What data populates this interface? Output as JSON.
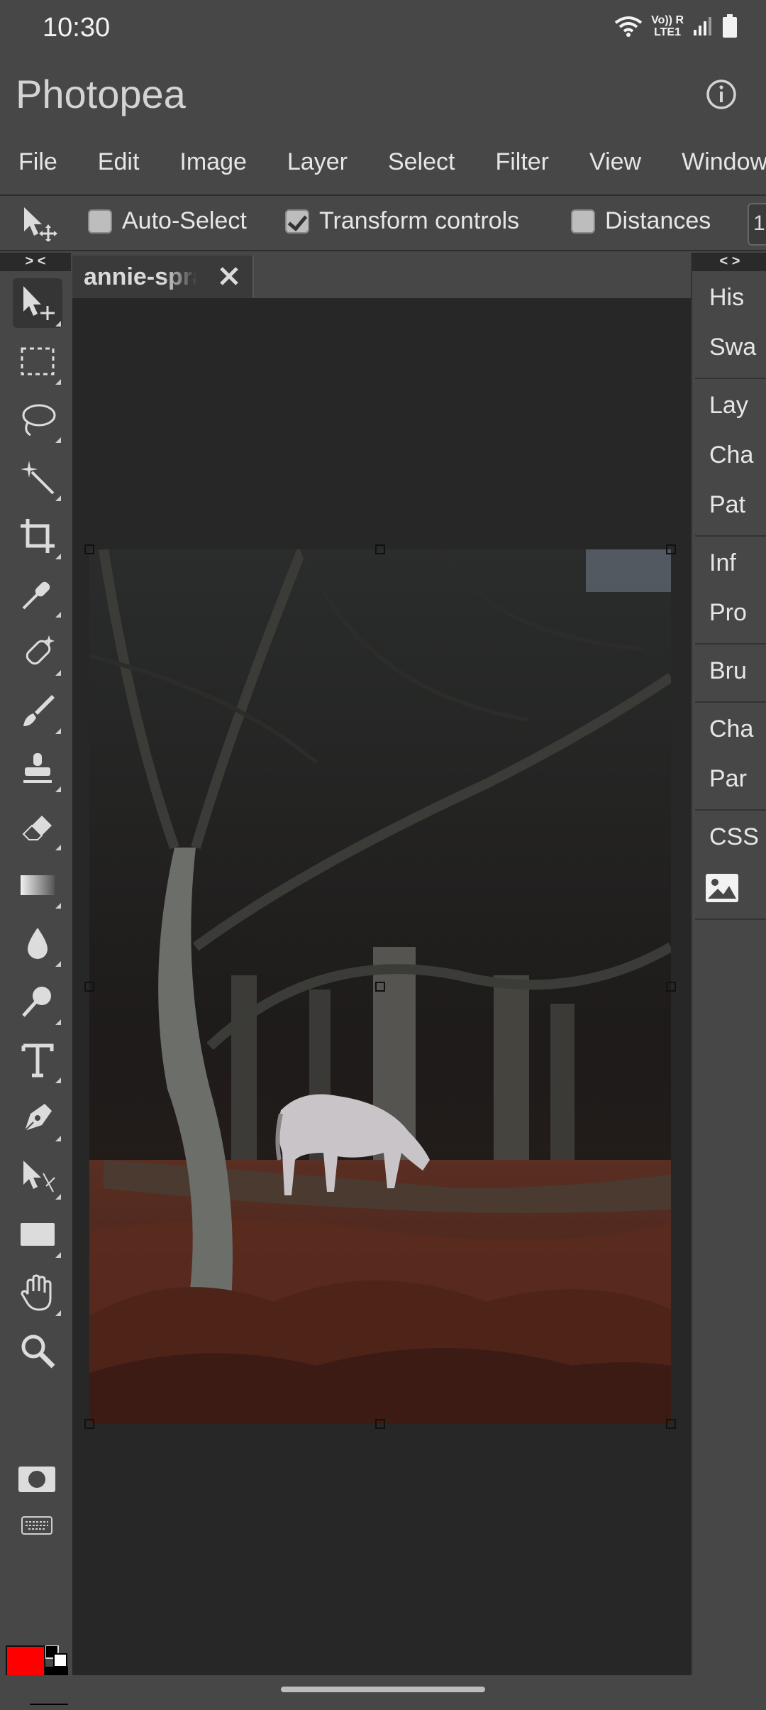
{
  "status": {
    "time": "10:30",
    "network_top": "Vo)) R",
    "network_bottom": "LTE1",
    "icons": [
      "wifi-icon",
      "signal-icon",
      "battery-icon"
    ]
  },
  "app": {
    "title": "Photopea",
    "info_icon": "info-icon"
  },
  "menu": [
    "File",
    "Edit",
    "Image",
    "Layer",
    "Select",
    "Filter",
    "View",
    "Window"
  ],
  "options": {
    "auto_select": {
      "label": "Auto-Select",
      "checked": false
    },
    "transform_controls": {
      "label": "Transform controls",
      "checked": true
    },
    "distances": {
      "label": "Distances",
      "checked": false
    },
    "overflow": "1"
  },
  "toolbar": {
    "toggle": "> <",
    "tools": [
      "move-tool",
      "marquee-tool",
      "lasso-tool",
      "magic-wand-tool",
      "crop-tool",
      "eyedropper-tool",
      "healing-brush-tool",
      "brush-tool",
      "clone-stamp-tool",
      "eraser-tool",
      "gradient-tool",
      "blur-tool",
      "dodge-tool",
      "type-tool",
      "pen-tool",
      "path-select-tool",
      "rectangle-tool",
      "hand-tool",
      "zoom-tool"
    ],
    "foreground_color": "#ff0000",
    "background_color": "#000000"
  },
  "document": {
    "tab_title": "annie-spratt",
    "image_description_icon": "photo"
  },
  "right_panel": {
    "toggle": "< >",
    "groups": [
      [
        "His",
        "Swa"
      ],
      [
        "Lay",
        "Cha",
        "Pat"
      ],
      [
        "Inf",
        "Pro"
      ],
      [
        "Bru"
      ],
      [
        "Cha",
        "Par"
      ],
      [
        "CSS"
      ]
    ]
  }
}
